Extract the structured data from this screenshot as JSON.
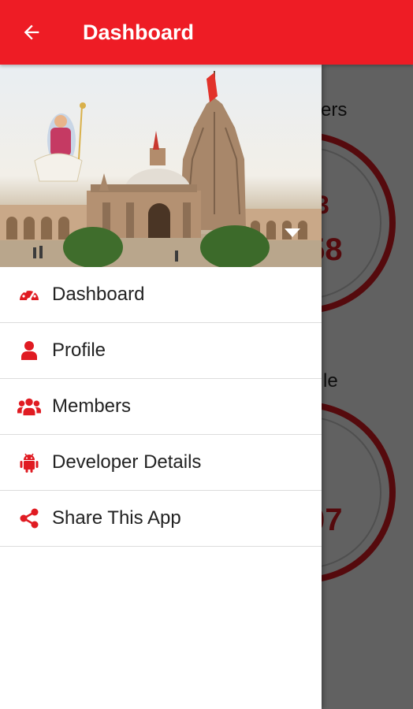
{
  "appbar": {
    "title": "Dashboard",
    "back_icon": "arrow-left-icon"
  },
  "background": {
    "card1": {
      "label_fragment": "ers",
      "number_top": "3",
      "number_fragment": "58"
    },
    "card2": {
      "label_fragment": "le",
      "number_fragment": "07"
    }
  },
  "drawer": {
    "items": [
      {
        "label": "Dashboard",
        "icon": "speedometer-icon"
      },
      {
        "label": "Profile",
        "icon": "person-icon"
      },
      {
        "label": "Members",
        "icon": "group-icon"
      },
      {
        "label": "Developer Details",
        "icon": "android-icon"
      },
      {
        "label": "Share This App",
        "icon": "share-icon"
      }
    ]
  },
  "colors": {
    "primary": "#ee1c25",
    "accent": "#e01b22"
  }
}
